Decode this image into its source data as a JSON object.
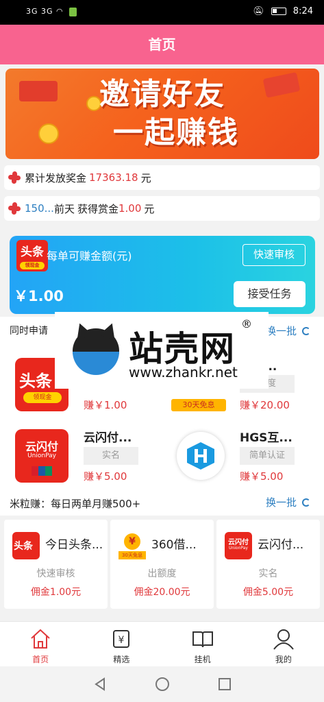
{
  "status_bar": {
    "signal_text": "3G 3G",
    "time": "8:24"
  },
  "header": {
    "title": "首页"
  },
  "banner": {
    "line1": "邀请好友",
    "line2": "一起赚钱"
  },
  "stats": {
    "total_label": "累计发放奖金",
    "total_value": "17363.18",
    "total_unit": "元",
    "recent_user": "150...",
    "recent_time": "前天",
    "recent_label": "获得赏金",
    "recent_value": "1.00",
    "recent_unit": "元"
  },
  "task_card": {
    "logo_text": "头条",
    "logo_sub": "领现金",
    "label": "每单可赚金额(元)",
    "fast_button": "快速审核",
    "amount": "￥1.00",
    "accept_button": "接受任务"
  },
  "section1": {
    "title": "同时申请",
    "action": "换一批",
    "items": [
      {
        "name": "",
        "tag": "",
        "earn": "赚￥1.00",
        "logo_text": "头条",
        "logo_sub": "领现金"
      },
      {
        "name": "借...",
        "tag": "额度",
        "earn": "赚￥20.00",
        "logo_text": "30天免息"
      },
      {
        "name": "云闪付...",
        "tag": "实名",
        "earn": "赚￥5.00",
        "logo_text": "云闪付",
        "logo_sub": "UnionPay"
      },
      {
        "name": "HGS互...",
        "tag": "简单认证",
        "earn": "赚￥5.00"
      }
    ]
  },
  "watermark": {
    "title": "站壳网",
    "reg": "®",
    "url": "www.zhankr.net"
  },
  "section2": {
    "title": "米粒赚：每日两单月赚500+",
    "action": "换一批",
    "cards": [
      {
        "name": "今日头条...",
        "tag": "快速审核",
        "fee": "佣金1.00元",
        "logo_text": "头条"
      },
      {
        "name": "360借...",
        "tag": "出额度",
        "fee": "佣金20.00元",
        "logo_text": "¥",
        "logo_sub": "30天免息"
      },
      {
        "name": "云闪付...",
        "tag": "实名",
        "fee": "佣金5.00元",
        "logo_text": "云闪付",
        "logo_sub": "UnionPay"
      }
    ]
  },
  "tabs": [
    {
      "label": "首页",
      "icon": "home-icon"
    },
    {
      "label": "精选",
      "icon": "yen-box-icon"
    },
    {
      "label": "挂机",
      "icon": "book-icon"
    },
    {
      "label": "我的",
      "icon": "user-icon"
    }
  ],
  "colors": {
    "header": "#f8638f",
    "accent_red": "#e0383b",
    "link_blue": "#2d7fc1"
  }
}
